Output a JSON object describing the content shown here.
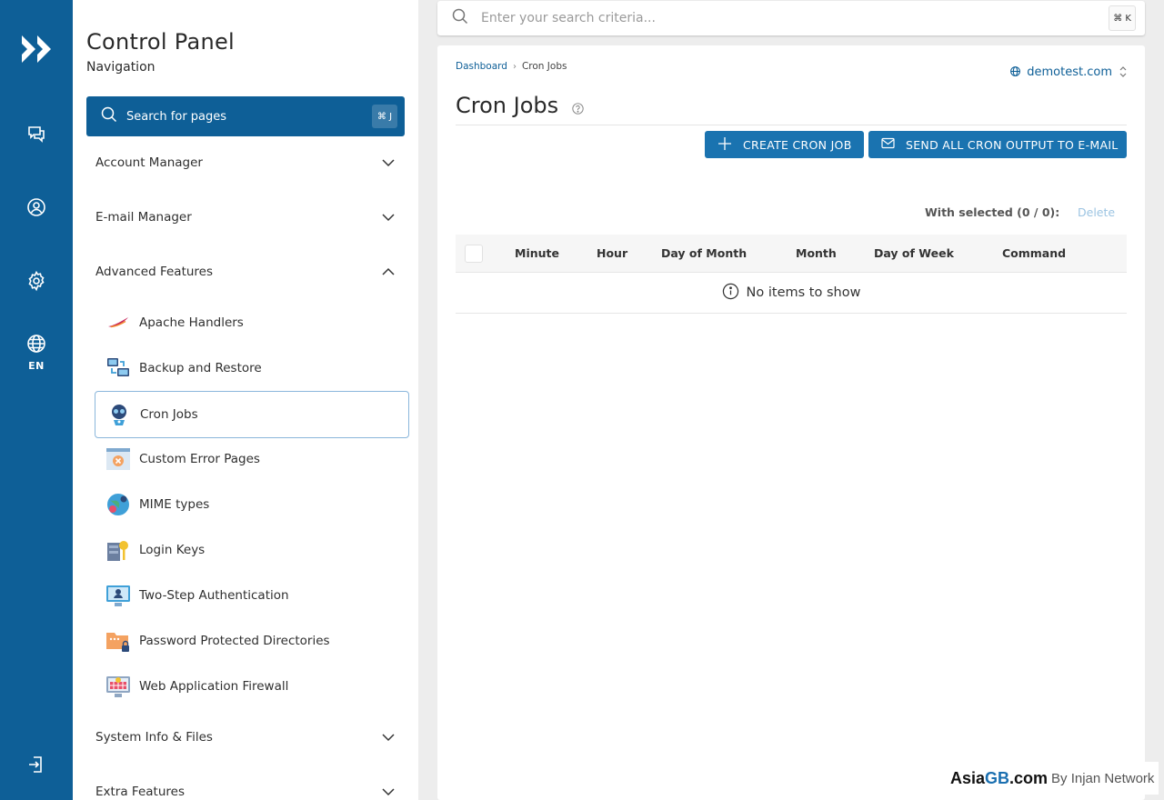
{
  "rail": {
    "language": "EN",
    "icons": [
      "logo-icon",
      "chat-icon",
      "user-icon",
      "settings-icon",
      "globe-icon",
      "logout-icon"
    ]
  },
  "nav": {
    "title": "Control Panel",
    "subtitle": "Navigation",
    "search_label": "Search for pages",
    "search_shortcut": "⌘ J",
    "sections": [
      {
        "label": "Account Manager",
        "expanded": false
      },
      {
        "label": "E-mail Manager",
        "expanded": false
      },
      {
        "label": "Advanced Features",
        "expanded": true
      },
      {
        "label": "System Info & Files",
        "expanded": false
      },
      {
        "label": "Extra Features",
        "expanded": false
      }
    ],
    "advanced_items": [
      {
        "label": "Apache Handlers",
        "icon": "feather-icon"
      },
      {
        "label": "Backup and Restore",
        "icon": "backup-icon"
      },
      {
        "label": "Cron Jobs",
        "icon": "robot-icon",
        "active": true
      },
      {
        "label": "Custom Error Pages",
        "icon": "error-page-icon"
      },
      {
        "label": "MIME types",
        "icon": "mime-globe-icon"
      },
      {
        "label": "Login Keys",
        "icon": "key-icon"
      },
      {
        "label": "Two-Step Authentication",
        "icon": "two-step-icon"
      },
      {
        "label": "Password Protected Directories",
        "icon": "locked-folder-icon"
      },
      {
        "label": "Web Application Firewall",
        "icon": "firewall-icon"
      }
    ]
  },
  "topsearch": {
    "placeholder": "Enter your search criteria...",
    "shortcut": "⌘ K"
  },
  "main": {
    "breadcrumb": [
      "Dashboard",
      "Cron Jobs"
    ],
    "domain": "demotest.com",
    "title": "Cron Jobs",
    "buttons": {
      "create": "CREATE CRON JOB",
      "send_all": "SEND ALL CRON OUTPUT TO E-MAIL"
    },
    "with_selected": "With selected (0 / 0):",
    "delete_label": "Delete",
    "columns": [
      "Minute",
      "Hour",
      "Day of Month",
      "Month",
      "Day of Week",
      "Command"
    ],
    "rows": [],
    "empty_message": "No items to show"
  },
  "watermark": {
    "part1": "Asia",
    "part2": "GB",
    "part3": ".com",
    "tagline": "By Injan Network"
  },
  "colors": {
    "primary": "#0e5f97",
    "button": "#1a73b0",
    "background": "#ededed"
  }
}
